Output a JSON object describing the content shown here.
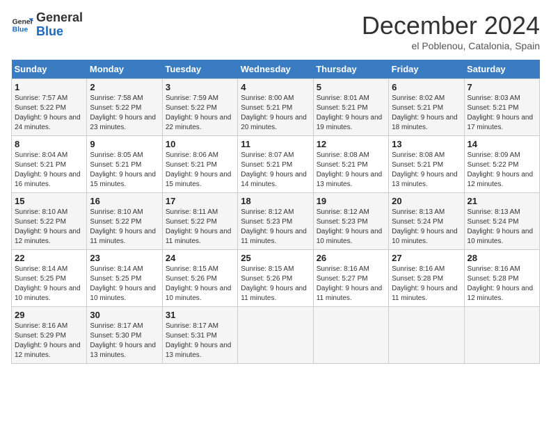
{
  "logo": {
    "line1": "General",
    "line2": "Blue"
  },
  "title": "December 2024",
  "subtitle": "el Poblenou, Catalonia, Spain",
  "weekdays": [
    "Sunday",
    "Monday",
    "Tuesday",
    "Wednesday",
    "Thursday",
    "Friday",
    "Saturday"
  ],
  "weeks": [
    [
      {
        "day": "1",
        "sunrise": "Sunrise: 7:57 AM",
        "sunset": "Sunset: 5:22 PM",
        "daylight": "Daylight: 9 hours and 24 minutes."
      },
      {
        "day": "2",
        "sunrise": "Sunrise: 7:58 AM",
        "sunset": "Sunset: 5:22 PM",
        "daylight": "Daylight: 9 hours and 23 minutes."
      },
      {
        "day": "3",
        "sunrise": "Sunrise: 7:59 AM",
        "sunset": "Sunset: 5:22 PM",
        "daylight": "Daylight: 9 hours and 22 minutes."
      },
      {
        "day": "4",
        "sunrise": "Sunrise: 8:00 AM",
        "sunset": "Sunset: 5:21 PM",
        "daylight": "Daylight: 9 hours and 20 minutes."
      },
      {
        "day": "5",
        "sunrise": "Sunrise: 8:01 AM",
        "sunset": "Sunset: 5:21 PM",
        "daylight": "Daylight: 9 hours and 19 minutes."
      },
      {
        "day": "6",
        "sunrise": "Sunrise: 8:02 AM",
        "sunset": "Sunset: 5:21 PM",
        "daylight": "Daylight: 9 hours and 18 minutes."
      },
      {
        "day": "7",
        "sunrise": "Sunrise: 8:03 AM",
        "sunset": "Sunset: 5:21 PM",
        "daylight": "Daylight: 9 hours and 17 minutes."
      }
    ],
    [
      {
        "day": "8",
        "sunrise": "Sunrise: 8:04 AM",
        "sunset": "Sunset: 5:21 PM",
        "daylight": "Daylight: 9 hours and 16 minutes."
      },
      {
        "day": "9",
        "sunrise": "Sunrise: 8:05 AM",
        "sunset": "Sunset: 5:21 PM",
        "daylight": "Daylight: 9 hours and 15 minutes."
      },
      {
        "day": "10",
        "sunrise": "Sunrise: 8:06 AM",
        "sunset": "Sunset: 5:21 PM",
        "daylight": "Daylight: 9 hours and 15 minutes."
      },
      {
        "day": "11",
        "sunrise": "Sunrise: 8:07 AM",
        "sunset": "Sunset: 5:21 PM",
        "daylight": "Daylight: 9 hours and 14 minutes."
      },
      {
        "day": "12",
        "sunrise": "Sunrise: 8:08 AM",
        "sunset": "Sunset: 5:21 PM",
        "daylight": "Daylight: 9 hours and 13 minutes."
      },
      {
        "day": "13",
        "sunrise": "Sunrise: 8:08 AM",
        "sunset": "Sunset: 5:21 PM",
        "daylight": "Daylight: 9 hours and 13 minutes."
      },
      {
        "day": "14",
        "sunrise": "Sunrise: 8:09 AM",
        "sunset": "Sunset: 5:22 PM",
        "daylight": "Daylight: 9 hours and 12 minutes."
      }
    ],
    [
      {
        "day": "15",
        "sunrise": "Sunrise: 8:10 AM",
        "sunset": "Sunset: 5:22 PM",
        "daylight": "Daylight: 9 hours and 12 minutes."
      },
      {
        "day": "16",
        "sunrise": "Sunrise: 8:10 AM",
        "sunset": "Sunset: 5:22 PM",
        "daylight": "Daylight: 9 hours and 11 minutes."
      },
      {
        "day": "17",
        "sunrise": "Sunrise: 8:11 AM",
        "sunset": "Sunset: 5:22 PM",
        "daylight": "Daylight: 9 hours and 11 minutes."
      },
      {
        "day": "18",
        "sunrise": "Sunrise: 8:12 AM",
        "sunset": "Sunset: 5:23 PM",
        "daylight": "Daylight: 9 hours and 11 minutes."
      },
      {
        "day": "19",
        "sunrise": "Sunrise: 8:12 AM",
        "sunset": "Sunset: 5:23 PM",
        "daylight": "Daylight: 9 hours and 10 minutes."
      },
      {
        "day": "20",
        "sunrise": "Sunrise: 8:13 AM",
        "sunset": "Sunset: 5:24 PM",
        "daylight": "Daylight: 9 hours and 10 minutes."
      },
      {
        "day": "21",
        "sunrise": "Sunrise: 8:13 AM",
        "sunset": "Sunset: 5:24 PM",
        "daylight": "Daylight: 9 hours and 10 minutes."
      }
    ],
    [
      {
        "day": "22",
        "sunrise": "Sunrise: 8:14 AM",
        "sunset": "Sunset: 5:25 PM",
        "daylight": "Daylight: 9 hours and 10 minutes."
      },
      {
        "day": "23",
        "sunrise": "Sunrise: 8:14 AM",
        "sunset": "Sunset: 5:25 PM",
        "daylight": "Daylight: 9 hours and 10 minutes."
      },
      {
        "day": "24",
        "sunrise": "Sunrise: 8:15 AM",
        "sunset": "Sunset: 5:26 PM",
        "daylight": "Daylight: 9 hours and 10 minutes."
      },
      {
        "day": "25",
        "sunrise": "Sunrise: 8:15 AM",
        "sunset": "Sunset: 5:26 PM",
        "daylight": "Daylight: 9 hours and 11 minutes."
      },
      {
        "day": "26",
        "sunrise": "Sunrise: 8:16 AM",
        "sunset": "Sunset: 5:27 PM",
        "daylight": "Daylight: 9 hours and 11 minutes."
      },
      {
        "day": "27",
        "sunrise": "Sunrise: 8:16 AM",
        "sunset": "Sunset: 5:28 PM",
        "daylight": "Daylight: 9 hours and 11 minutes."
      },
      {
        "day": "28",
        "sunrise": "Sunrise: 8:16 AM",
        "sunset": "Sunset: 5:28 PM",
        "daylight": "Daylight: 9 hours and 12 minutes."
      }
    ],
    [
      {
        "day": "29",
        "sunrise": "Sunrise: 8:16 AM",
        "sunset": "Sunset: 5:29 PM",
        "daylight": "Daylight: 9 hours and 12 minutes."
      },
      {
        "day": "30",
        "sunrise": "Sunrise: 8:17 AM",
        "sunset": "Sunset: 5:30 PM",
        "daylight": "Daylight: 9 hours and 13 minutes."
      },
      {
        "day": "31",
        "sunrise": "Sunrise: 8:17 AM",
        "sunset": "Sunset: 5:31 PM",
        "daylight": "Daylight: 9 hours and 13 minutes."
      },
      null,
      null,
      null,
      null
    ]
  ]
}
